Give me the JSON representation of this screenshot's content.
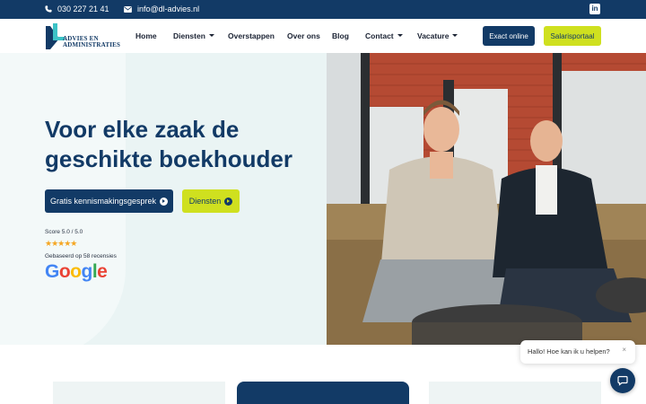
{
  "topbar": {
    "phone": "030 227 21 41",
    "email": "info@dl-advies.nl",
    "social_icon": "linkedin-icon"
  },
  "logo": {
    "line1": "ADVIES EN",
    "line2": "ADMINISTRATIES"
  },
  "nav": {
    "items": [
      {
        "label": "Home",
        "dropdown": false
      },
      {
        "label": "Diensten",
        "dropdown": true
      },
      {
        "label": "Overstappen",
        "dropdown": false
      },
      {
        "label": "Over ons",
        "dropdown": false
      },
      {
        "label": "Blog",
        "dropdown": false
      },
      {
        "label": "Contact",
        "dropdown": true
      },
      {
        "label": "Vacature",
        "dropdown": true
      }
    ],
    "exact_button": "Exact online",
    "salaris_button": "Salarisportaal"
  },
  "hero": {
    "title": "Voor elke zaak de geschikte boekhouder",
    "primary_button": "Gratis kennismakingsgesprek",
    "secondary_button": "Diensten",
    "score": "Score 5.0 / 5.0",
    "rating": 5,
    "stars": "★★★★★",
    "reviews": "Gebaseerd op 58 recensies"
  },
  "google": {
    "letters": [
      {
        "char": "G",
        "color": "#4285F4"
      },
      {
        "char": "o",
        "color": "#EA4335"
      },
      {
        "char": "o",
        "color": "#FBBC05"
      },
      {
        "char": "g",
        "color": "#4285F4"
      },
      {
        "char": "l",
        "color": "#34A853"
      },
      {
        "char": "e",
        "color": "#EA4335"
      }
    ]
  },
  "chat": {
    "message": "Hallo! Hoe kan ik u helpen?",
    "close": "×"
  },
  "colors": {
    "brand_navy": "#123a66",
    "brand_lime": "#cfe01f",
    "hero_bg": "#eaf4f4"
  }
}
